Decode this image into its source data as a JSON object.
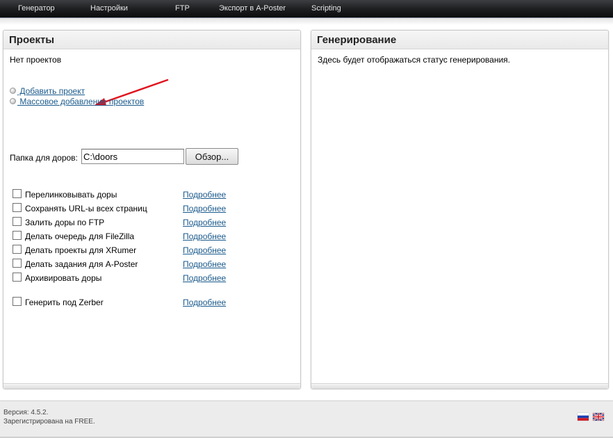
{
  "menu": [
    {
      "label": "Генератор"
    },
    {
      "label": "Настройки"
    },
    {
      "label": "FTP"
    },
    {
      "label": "Экспорт в A-Poster"
    },
    {
      "label": "Scripting"
    }
  ],
  "projects": {
    "title": "Проекты",
    "empty_text": "Нет проектов",
    "add_project": " Добавить проект",
    "bulk_add": " Массовое добавление проектов",
    "folder_label": "Папка для доров:",
    "folder_value": "C:\\doors",
    "browse_label": "Обзор...",
    "options": [
      {
        "label": "Перелинковывать доры",
        "more": "Подробнее",
        "checked": false
      },
      {
        "label": "Сохранять URL-ы всех страниц",
        "more": "Подробнее",
        "checked": false
      },
      {
        "label": "Залить доры по FTP",
        "more": "Подробнее",
        "checked": false
      },
      {
        "label": "Делать очередь для FileZilla",
        "more": "Подробнее",
        "checked": false
      },
      {
        "label": "Делать проекты для XRumer",
        "more": "Подробнее",
        "checked": false
      },
      {
        "label": "Делать задания для A-Poster",
        "more": "Подробнее",
        "checked": false
      },
      {
        "label": "Архивировать доры",
        "more": "Подробнее",
        "checked": false
      },
      {
        "label": "Генерить под Zerber",
        "more": "Подробнее",
        "checked": false
      }
    ]
  },
  "generation": {
    "title": "Генерирование",
    "status_text": "Здесь будет отображаться статус генерирования."
  },
  "footer": {
    "version": "Версия: 4.5.2.",
    "registered": "Зарегистрирована на FREE."
  },
  "icons": {
    "flag_ru": "russian-flag-icon",
    "flag_en": "uk-flag-icon",
    "annotation": "red-arrow-icon"
  },
  "colors": {
    "link": "#1a5a8c",
    "arrow": "#e0141e",
    "topbar": "#1c1d1f"
  }
}
